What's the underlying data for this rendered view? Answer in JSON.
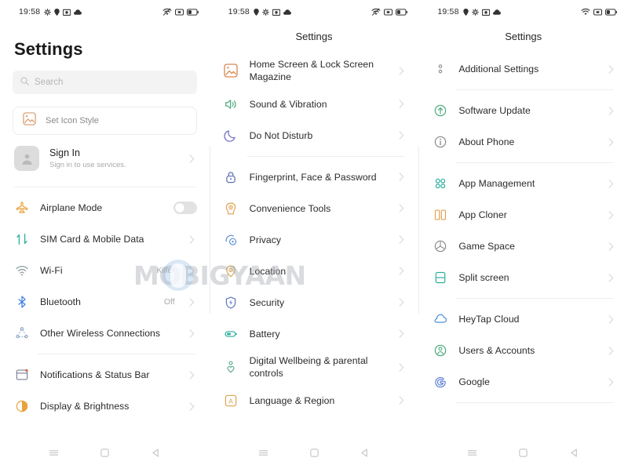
{
  "statusbar": {
    "time": "19:58",
    "left_icons": [
      "gear-icon",
      "location-pin-icon",
      "camera-icon",
      "cloud-icon"
    ],
    "right_icons": [
      "wifi-off-icon",
      "signal-icon",
      "battery-icon"
    ]
  },
  "watermark": {
    "text": "MOBIGYAAN"
  },
  "navbar": {
    "recents_label": "recents-button",
    "home_label": "home-button",
    "back_label": "back-button"
  },
  "panel1": {
    "title": "Settings",
    "search": {
      "placeholder": "Search",
      "icon": "search-icon"
    },
    "icon_style": {
      "label": "Set Icon Style",
      "icon": "picture-icon"
    },
    "account": {
      "title": "Sign In",
      "subtitle": "Sign in to use services.",
      "avatar_icon": "person-icon"
    },
    "groups": [
      {
        "items": [
          {
            "label": "Airplane Mode",
            "icon": "airplane-icon",
            "color": "#e8a33d",
            "control": "toggle",
            "toggle_on": false
          },
          {
            "label": "SIM Card & Mobile Data",
            "icon": "sim-data-icon",
            "color": "#2bae9b",
            "control": "chevron",
            "value": ""
          },
          {
            "label": "Wi-Fi",
            "icon": "wifi-icon",
            "color": "#7a9aa6",
            "control": "chevron",
            "value": "Killer"
          },
          {
            "label": "Bluetooth",
            "icon": "bluetooth-icon",
            "color": "#3f7fe0",
            "control": "chevron",
            "value": "Off"
          },
          {
            "label": "Other Wireless Connections",
            "icon": "wireless-share-icon",
            "color": "#8fa4c4",
            "control": "chevron",
            "value": ""
          }
        ]
      },
      {
        "items": [
          {
            "label": "Notifications & Status Bar",
            "icon": "notification-bar-icon",
            "color": "#7b7f99",
            "control": "chevron",
            "value": ""
          },
          {
            "label": "Display & Brightness",
            "icon": "brightness-icon",
            "color": "#e8a33d",
            "control": "chevron",
            "value": ""
          }
        ]
      }
    ]
  },
  "panel2": {
    "title": "Settings",
    "groups": [
      {
        "items": [
          {
            "label": "Home Screen & Lock Screen Magazine",
            "icon": "picture-icon",
            "color": "#d9864f",
            "control": "chevron",
            "value": ""
          },
          {
            "label": "Sound & Vibration",
            "icon": "speaker-icon",
            "color": "#4aa87a",
            "control": "chevron",
            "value": ""
          },
          {
            "label": "Do Not Disturb",
            "icon": "moon-icon",
            "color": "#6f6fc4",
            "control": "chevron",
            "value": ""
          }
        ]
      },
      {
        "items": [
          {
            "label": "Fingerprint, Face & Password",
            "icon": "lock-icon",
            "color": "#5a6fae",
            "control": "chevron",
            "value": ""
          },
          {
            "label": "Convenience Tools",
            "icon": "head-gear-icon",
            "color": "#e0a24e",
            "control": "chevron",
            "value": ""
          },
          {
            "label": "Privacy",
            "icon": "privacy-icon",
            "color": "#5c8fd6",
            "control": "chevron",
            "value": ""
          },
          {
            "label": "Location",
            "icon": "location-pin-icon",
            "color": "#d8ab5c",
            "control": "chevron",
            "value": ""
          },
          {
            "label": "Security",
            "icon": "shield-icon",
            "color": "#5a79c0",
            "control": "chevron",
            "value": ""
          },
          {
            "label": "Battery",
            "icon": "battery-icon",
            "color": "#2bae9b",
            "control": "chevron",
            "value": ""
          },
          {
            "label": "Digital Wellbeing & parental controls",
            "icon": "wellbeing-icon",
            "color": "#5ba890",
            "control": "chevron",
            "value": ""
          },
          {
            "label": "Language & Region",
            "icon": "language-icon",
            "color": "#d9a24e",
            "control": "chevron",
            "value": ""
          }
        ]
      }
    ]
  },
  "panel3": {
    "title": "Settings",
    "groups": [
      {
        "items": [
          {
            "label": "Additional Settings",
            "icon": "more-dots-icon",
            "color": "#8a8a8a",
            "control": "chevron",
            "value": ""
          }
        ]
      },
      {
        "items": [
          {
            "label": "Software Update",
            "icon": "update-icon",
            "color": "#4aa87a",
            "control": "chevron",
            "value": ""
          },
          {
            "label": "About Phone",
            "icon": "info-icon",
            "color": "#8a8a8a",
            "control": "chevron",
            "value": ""
          }
        ]
      },
      {
        "items": [
          {
            "label": "App Management",
            "icon": "apps-grid-icon",
            "color": "#2bae9b",
            "control": "chevron",
            "value": ""
          },
          {
            "label": "App Cloner",
            "icon": "app-cloner-icon",
            "color": "#e0a24e",
            "control": "chevron",
            "value": ""
          },
          {
            "label": "Game Space",
            "icon": "game-space-icon",
            "color": "#8a8a8a",
            "control": "chevron",
            "value": ""
          },
          {
            "label": "Split screen",
            "icon": "split-screen-icon",
            "color": "#2bae9b",
            "control": "chevron",
            "value": ""
          }
        ]
      },
      {
        "items": [
          {
            "label": "HeyTap Cloud",
            "icon": "cloud-icon",
            "color": "#4b90d6",
            "control": "chevron",
            "value": ""
          },
          {
            "label": "Users & Accounts",
            "icon": "users-icon",
            "color": "#4aa87a",
            "control": "chevron",
            "value": ""
          },
          {
            "label": "Google",
            "icon": "google-icon",
            "color": "#5a7fd6",
            "control": "chevron",
            "value": ""
          }
        ]
      }
    ]
  }
}
